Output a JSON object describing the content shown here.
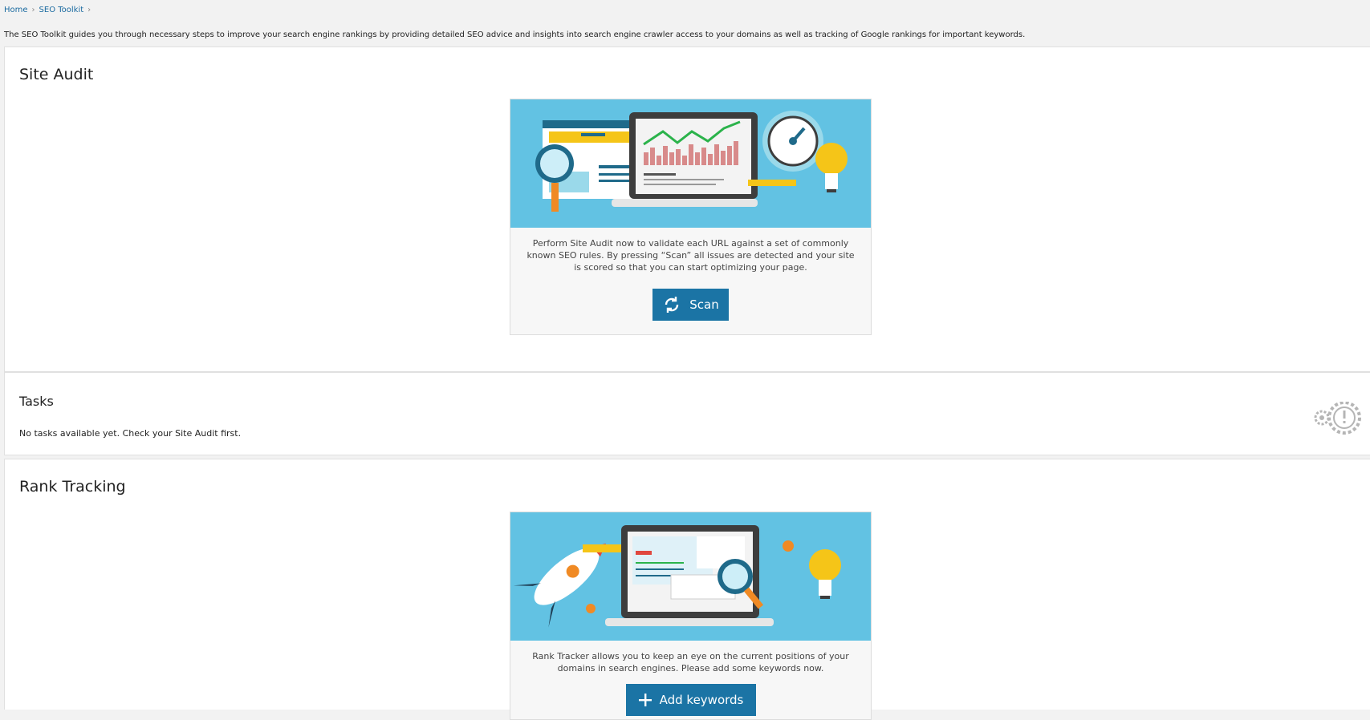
{
  "breadcrumb": {
    "items": [
      {
        "label": "Home"
      },
      {
        "label": "SEO Toolkit"
      }
    ]
  },
  "intro": "The SEO Toolkit guides you through necessary steps to improve your search engine rankings by providing detailed SEO advice and insights into search engine crawler access to your domains as well as tracking of Google rankings for important keywords.",
  "site_audit": {
    "title": "Site Audit",
    "description": "Perform Site Audit now to validate each URL against a set of commonly known SEO rules. By pressing “Scan” all issues are detected and your site is scored so that you can start optimizing your page.",
    "button_label": "Scan",
    "button_icon": "refresh-icon"
  },
  "tasks": {
    "title": "Tasks",
    "empty_text": "No tasks available yet. Check your Site Audit first.",
    "icon": "gears-warning-icon"
  },
  "rank_tracking": {
    "title": "Rank Tracking",
    "description": "Rank Tracker allows you to keep an eye on the current positions of your domains in search engines. Please add some keywords now.",
    "button_label": "Add keywords",
    "button_icon": "plus-icon"
  },
  "colors": {
    "accent": "#1b74a5",
    "link": "#1a6aa0",
    "illustration_bg": "#62c2e3"
  }
}
